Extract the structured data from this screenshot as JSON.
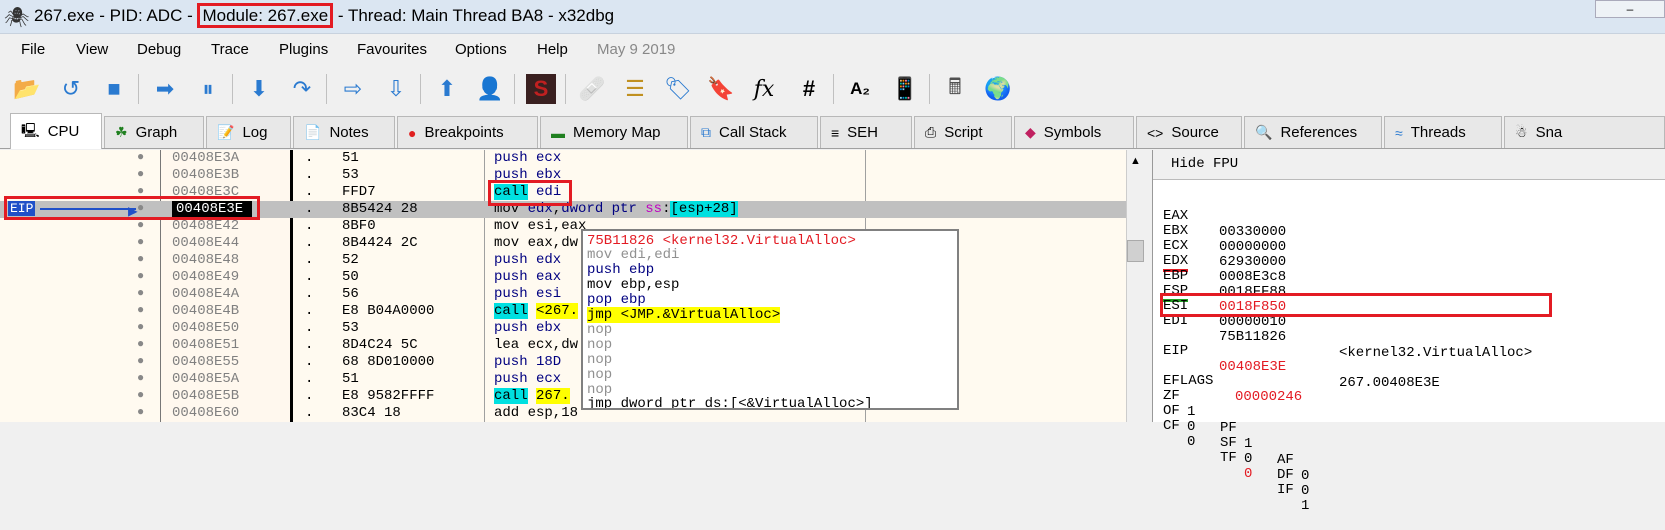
{
  "window": {
    "title_prefix": "267.exe - PID: ADC - ",
    "title_module": "Module: 267.exe",
    "title_suffix": " - Thread: Main Thread BA8 - x32dbg"
  },
  "menu": {
    "items": [
      "File",
      "View",
      "Debug",
      "Trace",
      "Plugins",
      "Favourites",
      "Options",
      "Help"
    ],
    "date": "May 9 2019"
  },
  "toolbar": {
    "icons": [
      "open-icon",
      "restart-icon",
      "stop-icon",
      "run-icon",
      "pause-icon",
      "step-into-icon",
      "step-over-icon",
      "trace-into-icon",
      "trace-over-icon",
      "execute-till-return-icon",
      "run-to-user-code-icon",
      "scylla-icon",
      "patch-icon",
      "comments-icon",
      "labels-icon",
      "bookmarks-icon",
      "functions-icon",
      "hash-icon",
      "font-icon",
      "device-icon",
      "calculator-icon",
      "globe-icon"
    ]
  },
  "tabs": [
    {
      "label": "CPU",
      "active": true
    },
    {
      "label": "Graph"
    },
    {
      "label": "Log"
    },
    {
      "label": "Notes"
    },
    {
      "label": "Breakpoints"
    },
    {
      "label": "Memory Map"
    },
    {
      "label": "Call Stack"
    },
    {
      "label": "SEH"
    },
    {
      "label": "Script"
    },
    {
      "label": "Symbols"
    },
    {
      "label": "Source"
    },
    {
      "label": "References"
    },
    {
      "label": "Threads"
    },
    {
      "label": "Sna"
    }
  ],
  "disasm": {
    "eip_label": "EIP",
    "rows": [
      {
        "addr": "00408E3A",
        "dot": ".",
        "hex": "51",
        "asm": "push ecx"
      },
      {
        "addr": "00408E3B",
        "dot": ".",
        "hex": "53",
        "asm": "push ebx"
      },
      {
        "addr": "00408E3C",
        "dot": ".",
        "hex": "FFD7",
        "asm": "call edi"
      },
      {
        "addr": "00408E3E",
        "dot": ".",
        "hex": "8B5424 28",
        "asm": "mov edx,dword ptr ss:[esp+28]"
      },
      {
        "addr": "00408E42",
        "dot": ".",
        "hex": "8BF0",
        "asm": "mov esi,eax"
      },
      {
        "addr": "00408E44",
        "dot": ".",
        "hex": "8B4424 2C",
        "asm": "mov eax,dw"
      },
      {
        "addr": "00408E48",
        "dot": ".",
        "hex": "52",
        "asm": "push edx"
      },
      {
        "addr": "00408E49",
        "dot": ".",
        "hex": "50",
        "asm": "push eax"
      },
      {
        "addr": "00408E4A",
        "dot": ".",
        "hex": "56",
        "asm": "push esi"
      },
      {
        "addr": "00408E4B",
        "dot": ".",
        "hex": "E8 B04A0000",
        "asm": "call <267."
      },
      {
        "addr": "00408E50",
        "dot": ".",
        "hex": "53",
        "asm": "push ebx"
      },
      {
        "addr": "00408E51",
        "dot": ".",
        "hex": "8D4C24 5C",
        "asm": "lea ecx,dw"
      },
      {
        "addr": "00408E55",
        "dot": ".",
        "hex": "68 8D010000",
        "asm": "push 18D"
      },
      {
        "addr": "00408E5A",
        "dot": ".",
        "hex": "51",
        "asm": "push ecx"
      },
      {
        "addr": "00408E5B",
        "dot": ".",
        "hex": "E8 9582FFFF",
        "asm": "call 267."
      },
      {
        "addr": "00408E60",
        "dot": ".",
        "hex": "83C4 18",
        "asm": "add esp,18"
      }
    ]
  },
  "popup": {
    "header": "75B11826 <kernel32.VirtualAlloc>",
    "lines": [
      "mov edi,edi",
      "push ebp",
      "mov ebp,esp",
      "pop ebp",
      "jmp <JMP.&VirtualAlloc>",
      "nop",
      "nop",
      "nop",
      "nop",
      "nop",
      "nop",
      "jmp dword ptr ds:[<&VirtualAlloc>]"
    ]
  },
  "registers": {
    "hide_fpu": "Hide FPU",
    "list": [
      {
        "name": "EAX",
        "value": "00330000",
        "comment": ""
      },
      {
        "name": "EBX",
        "value": "00000000",
        "comment": ""
      },
      {
        "name": "ECX",
        "value": "62930000",
        "comment": ""
      },
      {
        "name": "EDX",
        "value": "0008E3c8",
        "comment": ""
      },
      {
        "name": "EBP",
        "value": "0018FF88",
        "comment": ""
      },
      {
        "name": "ESP",
        "value": "0018F850",
        "comment": ""
      },
      {
        "name": "ESI",
        "value": "00000010",
        "comment": ""
      },
      {
        "name": "EDI",
        "value": "75B11826",
        "comment": "<kernel32.VirtualAlloc>"
      }
    ],
    "eip": {
      "name": "EIP",
      "value": "00408E3E",
      "comment": "267.00408E3E"
    },
    "eflags": {
      "name": "EFLAGS",
      "value": "00000246"
    },
    "flags": [
      [
        "ZF",
        "1",
        "PF",
        "1",
        "AF",
        "0"
      ],
      [
        "OF",
        "0",
        "SF",
        "0",
        "DF",
        "0"
      ],
      [
        "CF",
        "0",
        "TF",
        "0",
        "IF",
        "1"
      ]
    ]
  },
  "colors": {
    "highlight_red": "#e31b23",
    "cyan": "#00e0e0",
    "yellow": "#ffff00"
  }
}
